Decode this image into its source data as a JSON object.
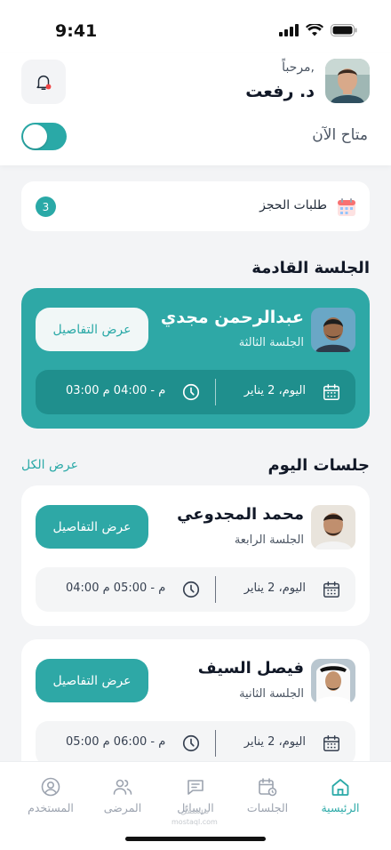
{
  "status_bar": {
    "time": "9:41"
  },
  "header": {
    "greeting": "مرحباً,",
    "doctor_name": "د. رفعت",
    "availability_label": "متاح الآن",
    "availability_on": true
  },
  "booking_requests": {
    "label": "طلبات الحجز",
    "count": "3"
  },
  "upcoming": {
    "section_title": "الجلسة القادمة",
    "patient_name": "عبدالرحمن مجدي",
    "session_label": "الجلسة الثالثة",
    "details_button": "عرض التفاصيل",
    "date": "اليوم، 2 يناير",
    "time": "03:00 م - 04:00 م"
  },
  "today": {
    "section_title": "جلسات اليوم",
    "see_all": "عرض الكل",
    "sessions": [
      {
        "patient_name": "محمد المجدوعي",
        "session_label": "الجلسة الرابعة",
        "details_button": "عرض التفاصيل",
        "date": "اليوم، 2 يناير",
        "time": "04:00 م - 05:00 م"
      },
      {
        "patient_name": "فيصل السيف",
        "session_label": "الجلسة الثانية",
        "details_button": "عرض التفاصيل",
        "date": "اليوم، 2 يناير",
        "time": "05:00 م - 06:00 م"
      }
    ]
  },
  "bottom_nav": {
    "items": [
      {
        "label": "الرئيسية",
        "icon": "home-icon",
        "active": true
      },
      {
        "label": "الجلسات",
        "icon": "calendar-clock-icon",
        "active": false
      },
      {
        "label": "الرسائل",
        "icon": "message-icon",
        "active": false
      },
      {
        "label": "المرضى",
        "icon": "users-icon",
        "active": false
      },
      {
        "label": "المستخدم",
        "icon": "user-circle-icon",
        "active": false
      }
    ]
  },
  "watermark": {
    "line1": "مستقل",
    "line2": "mostaql.com"
  },
  "colors": {
    "accent": "#2aa9a7",
    "accent_dark": "#1f8f8d",
    "background": "#f3f4f6",
    "notification_dot": "#ef4444"
  }
}
